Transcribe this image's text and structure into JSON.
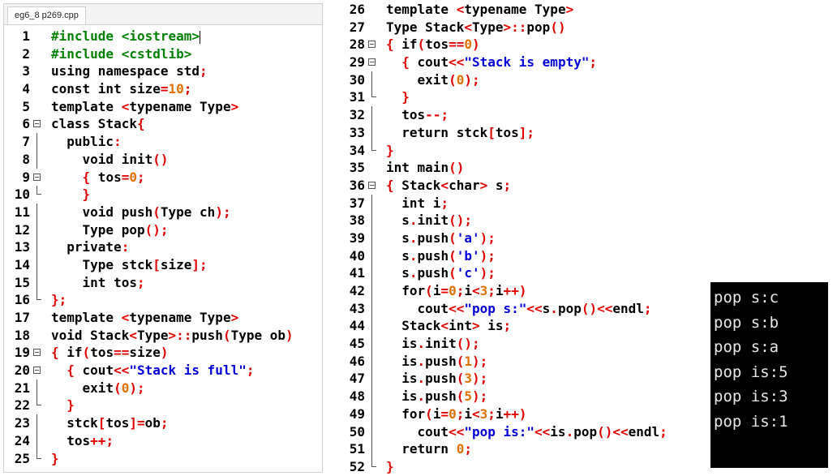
{
  "left_panel": {
    "tab_label": "eg6_8 p269.cpp",
    "lines": [
      {
        "n": "1",
        "fold": "",
        "html": "<span class='pp'>#include &lt;iostream&gt;</span><span class='cursor'></span>"
      },
      {
        "n": "2",
        "fold": "",
        "html": "<span class='pp'>#include &lt;cstdlib&gt;</span>"
      },
      {
        "n": "3",
        "fold": "",
        "html": "<span class='k'>using namespace</span> std<span class='op'>;</span>"
      },
      {
        "n": "4",
        "fold": "",
        "html": "<span class='k'>const int</span> size<span class='op'>=</span><span class='num'>10</span><span class='op'>;</span>"
      },
      {
        "n": "5",
        "fold": "",
        "html": "<span class='k'>template</span> <span class='op'>&lt;</span><span class='k'>typename</span> Type<span class='op'>&gt;</span>"
      },
      {
        "n": "6",
        "fold": "start",
        "html": "<span class='k'>class</span> Stack<span class='op'>{</span>"
      },
      {
        "n": "7",
        "fold": "mid",
        "html": "  <span class='k'>public</span><span class='op'>:</span>"
      },
      {
        "n": "8",
        "fold": "mid",
        "html": "    <span class='k'>void</span> init<span class='op'>()</span>"
      },
      {
        "n": "9",
        "fold": "start",
        "html": "    <span class='op'>{</span> tos<span class='op'>=</span><span class='num'>0</span><span class='op'>;</span>"
      },
      {
        "n": "10",
        "fold": "end",
        "html": "    <span class='op'>}</span>"
      },
      {
        "n": "11",
        "fold": "mid",
        "html": "    <span class='k'>void</span> push<span class='op'>(</span>Type ch<span class='op'>);</span>"
      },
      {
        "n": "12",
        "fold": "mid",
        "html": "    Type pop<span class='op'>();</span>"
      },
      {
        "n": "13",
        "fold": "mid",
        "html": "  <span class='k'>private</span><span class='op'>:</span>"
      },
      {
        "n": "14",
        "fold": "mid",
        "html": "    Type stck<span class='op'>[</span>size<span class='op'>];</span>"
      },
      {
        "n": "15",
        "fold": "mid",
        "html": "    <span class='k'>int</span> tos<span class='op'>;</span>"
      },
      {
        "n": "16",
        "fold": "end",
        "html": "<span class='op'>};</span>"
      },
      {
        "n": "17",
        "fold": "",
        "html": "<span class='k'>template</span> <span class='op'>&lt;</span><span class='k'>typename</span> Type<span class='op'>&gt;</span>"
      },
      {
        "n": "18",
        "fold": "",
        "html": "<span class='k'>void</span> Stack<span class='op'>&lt;</span>Type<span class='op'>&gt;::</span>push<span class='op'>(</span>Type ob<span class='op'>)</span>"
      },
      {
        "n": "19",
        "fold": "start",
        "html": "<span class='op'>{</span> <span class='k'>if</span><span class='op'>(</span>tos<span class='op'>==</span>size<span class='op'>)</span>"
      },
      {
        "n": "20",
        "fold": "start",
        "html": "  <span class='op'>{</span> cout<span class='op'>&lt;&lt;</span><span class='str'>\"Stack is full\"</span><span class='op'>;</span>"
      },
      {
        "n": "21",
        "fold": "mid",
        "html": "    exit<span class='op'>(</span><span class='num'>0</span><span class='op'>);</span>"
      },
      {
        "n": "22",
        "fold": "end",
        "html": "  <span class='op'>}</span>"
      },
      {
        "n": "23",
        "fold": "mid",
        "html": "  stck<span class='op'>[</span>tos<span class='op'>]=</span>ob<span class='op'>;</span>"
      },
      {
        "n": "24",
        "fold": "mid",
        "html": "  tos<span class='op'>++;</span>"
      },
      {
        "n": "25",
        "fold": "end",
        "html": "<span class='op'>}</span>"
      }
    ]
  },
  "middle_panel": {
    "lines": [
      {
        "n": "26",
        "fold": "",
        "html": "<span class='k'>template</span> <span class='op'>&lt;</span><span class='k'>typename</span> Type<span class='op'>&gt;</span>"
      },
      {
        "n": "27",
        "fold": "",
        "html": "Type Stack<span class='op'>&lt;</span>Type<span class='op'>&gt;::</span>pop<span class='op'>()</span>"
      },
      {
        "n": "28",
        "fold": "start",
        "html": "<span class='op'>{</span> <span class='k'>if</span><span class='op'>(</span>tos<span class='op'>==</span><span class='num'>0</span><span class='op'>)</span>"
      },
      {
        "n": "29",
        "fold": "start",
        "html": "  <span class='op'>{</span> cout<span class='op'>&lt;&lt;</span><span class='str'>\"Stack is empty\"</span><span class='op'>;</span>"
      },
      {
        "n": "30",
        "fold": "mid",
        "html": "    exit<span class='op'>(</span><span class='num'>0</span><span class='op'>);</span>"
      },
      {
        "n": "31",
        "fold": "end",
        "html": "  <span class='op'>}</span>"
      },
      {
        "n": "32",
        "fold": "mid",
        "html": "  tos<span class='op'>--;</span>"
      },
      {
        "n": "33",
        "fold": "mid",
        "html": "  <span class='k'>return</span> stck<span class='op'>[</span>tos<span class='op'>];</span>"
      },
      {
        "n": "34",
        "fold": "end",
        "html": "<span class='op'>}</span>"
      },
      {
        "n": "35",
        "fold": "",
        "html": "<span class='k'>int</span> main<span class='op'>()</span>"
      },
      {
        "n": "36",
        "fold": "start",
        "html": "<span class='op'>{</span> Stack<span class='op'>&lt;</span><span class='k'>char</span><span class='op'>&gt;</span> s<span class='op'>;</span>"
      },
      {
        "n": "37",
        "fold": "mid",
        "html": "  <span class='k'>int</span> i<span class='op'>;</span>"
      },
      {
        "n": "38",
        "fold": "mid",
        "html": "  s<span class='op'>.</span>init<span class='op'>();</span>"
      },
      {
        "n": "39",
        "fold": "mid",
        "html": "  s<span class='op'>.</span>push<span class='op'>(</span><span class='str'>'a'</span><span class='op'>);</span>"
      },
      {
        "n": "40",
        "fold": "mid",
        "html": "  s<span class='op'>.</span>push<span class='op'>(</span><span class='str'>'b'</span><span class='op'>);</span>"
      },
      {
        "n": "41",
        "fold": "mid",
        "html": "  s<span class='op'>.</span>push<span class='op'>(</span><span class='str'>'c'</span><span class='op'>);</span>"
      },
      {
        "n": "42",
        "fold": "mid",
        "html": "  <span class='k'>for</span><span class='op'>(</span>i<span class='op'>=</span><span class='num'>0</span><span class='op'>;</span>i<span class='op'>&lt;</span><span class='num'>3</span><span class='op'>;</span>i<span class='op'>++)</span>"
      },
      {
        "n": "43",
        "fold": "mid",
        "html": "    cout<span class='op'>&lt;&lt;</span><span class='str'>\"pop s:\"</span><span class='op'>&lt;&lt;</span>s<span class='op'>.</span>pop<span class='op'>()&lt;&lt;</span>endl<span class='op'>;</span>"
      },
      {
        "n": "44",
        "fold": "mid",
        "html": "  Stack<span class='op'>&lt;</span><span class='k'>int</span><span class='op'>&gt;</span> is<span class='op'>;</span>"
      },
      {
        "n": "45",
        "fold": "mid",
        "html": "  is<span class='op'>.</span>init<span class='op'>();</span>"
      },
      {
        "n": "46",
        "fold": "mid",
        "html": "  is<span class='op'>.</span>push<span class='op'>(</span><span class='num'>1</span><span class='op'>);</span>"
      },
      {
        "n": "47",
        "fold": "mid",
        "html": "  is<span class='op'>.</span>push<span class='op'>(</span><span class='num'>3</span><span class='op'>);</span>"
      },
      {
        "n": "48",
        "fold": "mid",
        "html": "  is<span class='op'>.</span>push<span class='op'>(</span><span class='num'>5</span><span class='op'>);</span>"
      },
      {
        "n": "49",
        "fold": "mid",
        "html": "  <span class='k'>for</span><span class='op'>(</span>i<span class='op'>=</span><span class='num'>0</span><span class='op'>;</span>i<span class='op'>&lt;</span><span class='num'>3</span><span class='op'>;</span>i<span class='op'>++)</span>"
      },
      {
        "n": "50",
        "fold": "mid",
        "html": "    cout<span class='op'>&lt;&lt;</span><span class='str'>\"pop is:\"</span><span class='op'>&lt;&lt;</span>is<span class='op'>.</span>pop<span class='op'>()&lt;&lt;</span>endl<span class='op'>;</span>"
      },
      {
        "n": "51",
        "fold": "mid",
        "html": "  <span class='k'>return</span> <span class='num'>0</span><span class='op'>;</span>"
      },
      {
        "n": "52",
        "fold": "end",
        "html": "<span class='op'>}</span>"
      }
    ]
  },
  "console": {
    "lines": [
      "pop s:c",
      "pop s:b",
      "pop s:a",
      "pop is:5",
      "pop is:3",
      "pop is:1"
    ]
  }
}
